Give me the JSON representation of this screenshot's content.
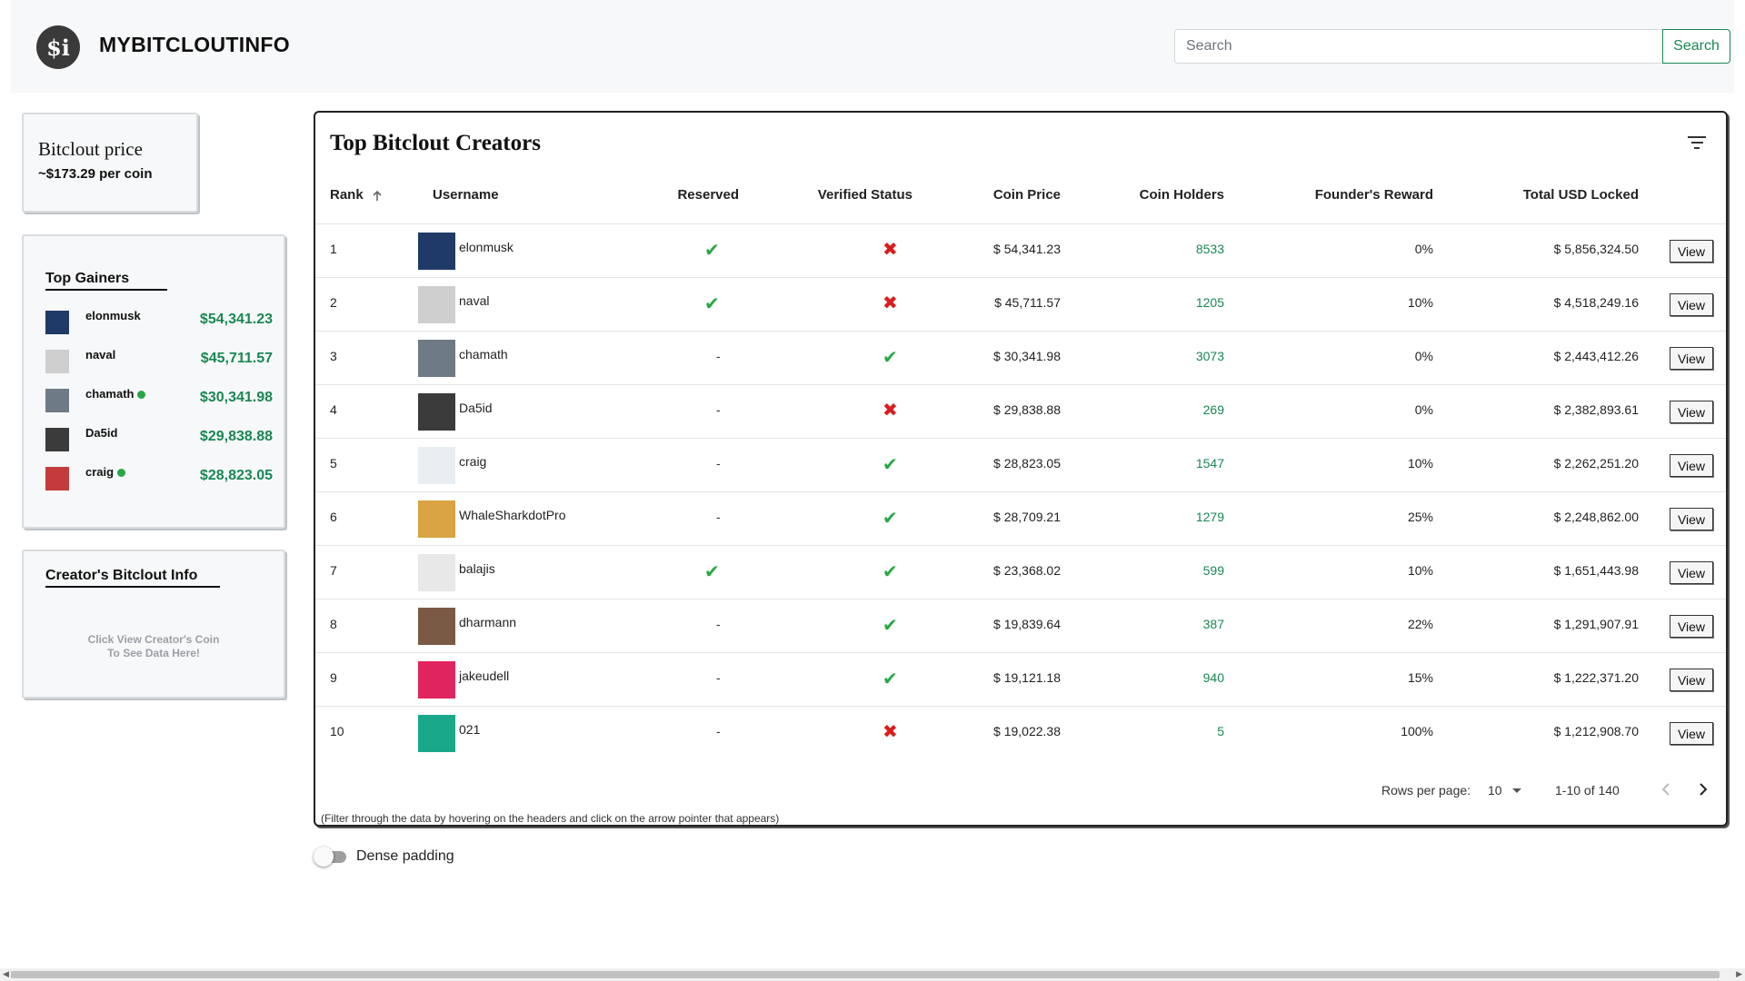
{
  "header": {
    "brand": "MYBITCLOUTINFO",
    "logo_icon": "bitclout-info-logo",
    "search_placeholder": "Search",
    "search_button": "Search"
  },
  "price_card": {
    "title": "Bitclout price",
    "value": "~$173.29 per coin"
  },
  "top_gainers": {
    "title": "Top Gainers",
    "items": [
      {
        "name": "elonmusk",
        "price": "$54,341.23",
        "verified": false,
        "avatar_color": "#1f3a66"
      },
      {
        "name": "naval",
        "price": "$45,711.57",
        "verified": false,
        "avatar_color": "#cfcfcf"
      },
      {
        "name": "chamath",
        "price": "$30,341.98",
        "verified": true,
        "avatar_color": "#6e7a86"
      },
      {
        "name": "Da5id",
        "price": "$29,838.88",
        "verified": false,
        "avatar_color": "#3b3b3b"
      },
      {
        "name": "craig",
        "price": "$28,823.05",
        "verified": true,
        "avatar_color": "#c43b3b"
      }
    ]
  },
  "creator_info": {
    "title": "Creator's Bitclout Info",
    "hint_line1": "Click View Creator's Coin",
    "hint_line2": "To See Data Here!"
  },
  "table": {
    "title": "Top Bitclout Creators",
    "columns": {
      "rank": "Rank",
      "username": "Username",
      "reserved": "Reserved",
      "verified": "Verified Status",
      "coin_price": "Coin Price",
      "holders": "Coin Holders",
      "reward": "Founder's Reward",
      "locked": "Total USD Locked"
    },
    "sort_icon": "arrow-up-icon",
    "view_label": "View",
    "rows": [
      {
        "rank": "1",
        "username": "elonmusk",
        "reserved": true,
        "verified": false,
        "coin_price": "$ 54,341.23",
        "holders": "8533",
        "reward": "0%",
        "locked": "$ 5,856,324.50",
        "avatar_color": "#1f3a66"
      },
      {
        "rank": "2",
        "username": "naval",
        "reserved": true,
        "verified": false,
        "coin_price": "$ 45,711.57",
        "holders": "1205",
        "reward": "10%",
        "locked": "$ 4,518,249.16",
        "avatar_color": "#cfcfcf"
      },
      {
        "rank": "3",
        "username": "chamath",
        "reserved": false,
        "verified": true,
        "coin_price": "$ 30,341.98",
        "holders": "3073",
        "reward": "0%",
        "locked": "$ 2,443,412.26",
        "avatar_color": "#6e7a86"
      },
      {
        "rank": "4",
        "username": "Da5id",
        "reserved": false,
        "verified": false,
        "coin_price": "$ 29,838.88",
        "holders": "269",
        "reward": "0%",
        "locked": "$ 2,382,893.61",
        "avatar_color": "#3b3b3b"
      },
      {
        "rank": "5",
        "username": "craig",
        "reserved": false,
        "verified": true,
        "coin_price": "$ 28,823.05",
        "holders": "1547",
        "reward": "10%",
        "locked": "$ 2,262,251.20",
        "avatar_color": "#e9eef2"
      },
      {
        "rank": "6",
        "username": "WhaleSharkdotPro",
        "reserved": false,
        "verified": true,
        "coin_price": "$ 28,709.21",
        "holders": "1279",
        "reward": "25%",
        "locked": "$ 2,248,862.00",
        "avatar_color": "#d9a441"
      },
      {
        "rank": "7",
        "username": "balajis",
        "reserved": true,
        "verified": true,
        "coin_price": "$ 23,368.02",
        "holders": "599",
        "reward": "10%",
        "locked": "$ 1,651,443.98",
        "avatar_color": "#e8e8e8"
      },
      {
        "rank": "8",
        "username": "dharmann",
        "reserved": false,
        "verified": true,
        "coin_price": "$ 19,839.64",
        "holders": "387",
        "reward": "22%",
        "locked": "$ 1,291,907.91",
        "avatar_color": "#7a5a45"
      },
      {
        "rank": "9",
        "username": "jakeudell",
        "reserved": false,
        "verified": true,
        "coin_price": "$ 19,121.18",
        "holders": "940",
        "reward": "15%",
        "locked": "$ 1,222,371.20",
        "avatar_color": "#e0245e"
      },
      {
        "rank": "10",
        "username": "021",
        "reserved": false,
        "verified": false,
        "coin_price": "$ 19,022.38",
        "holders": "5",
        "reward": "100%",
        "locked": "$ 1,212,908.70",
        "avatar_color": "#1aa88a"
      }
    ],
    "dash": "-",
    "check_glyph": "✔",
    "cross_glyph": "✖",
    "rows_per_page_label": "Rows per page:",
    "rows_per_page_value": "10",
    "page_range": "1-10 of 140",
    "footnote": "(Filter through the data by hovering on the headers and click on the arrow pointer that appears)"
  },
  "dense_padding": {
    "label": "Dense padding",
    "enabled": false
  },
  "colors": {
    "accent_green": "#198754",
    "check_green": "#28a745",
    "cross_red": "#dc1c1c"
  }
}
